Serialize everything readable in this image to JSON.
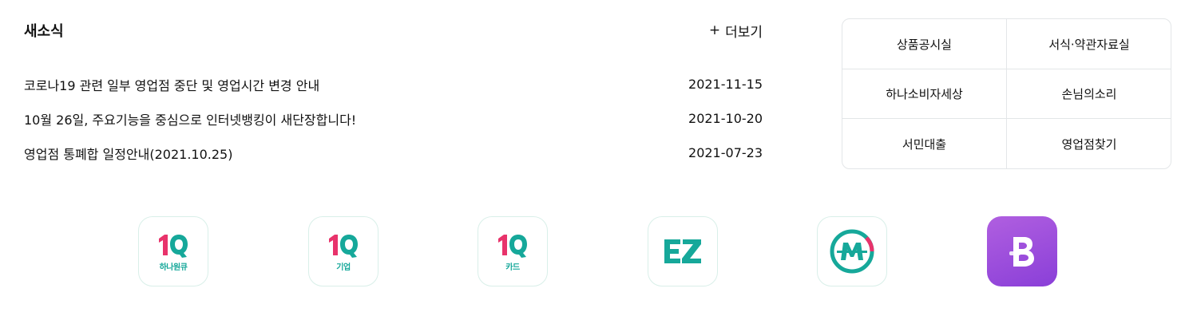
{
  "news": {
    "title": "새소식",
    "more_label": "더보기",
    "items": [
      {
        "title": "코로나19 관련 일부 영업점 중단 및 영업시간 변경 안내",
        "date": "2021-11-15"
      },
      {
        "title": "10월 26일, 주요기능을 중심으로 인터넷뱅킹이 새단장합니다!",
        "date": "2021-10-20"
      },
      {
        "title": "영업점 통폐합 일정안내(2021.10.25)",
        "date": "2021-07-23"
      }
    ]
  },
  "quick_menu": [
    "상품공시실",
    "서식·약관자료실",
    "하나소비자세상",
    "손님의소리",
    "서민대출",
    "영업점찾기"
  ],
  "apps": [
    {
      "icon": "1q-icon",
      "sub": "하나원큐"
    },
    {
      "icon": "1q-icon",
      "sub": "기업"
    },
    {
      "icon": "1q-icon",
      "sub": "카드"
    },
    {
      "icon": "ez-icon"
    },
    {
      "icon": "m-icon"
    },
    {
      "icon": "b-icon"
    }
  ],
  "colors": {
    "brand_teal": "#16a89a",
    "brand_pink": "#e8336b",
    "purple": "#9b4ddc",
    "border": "#e3e6e8"
  }
}
